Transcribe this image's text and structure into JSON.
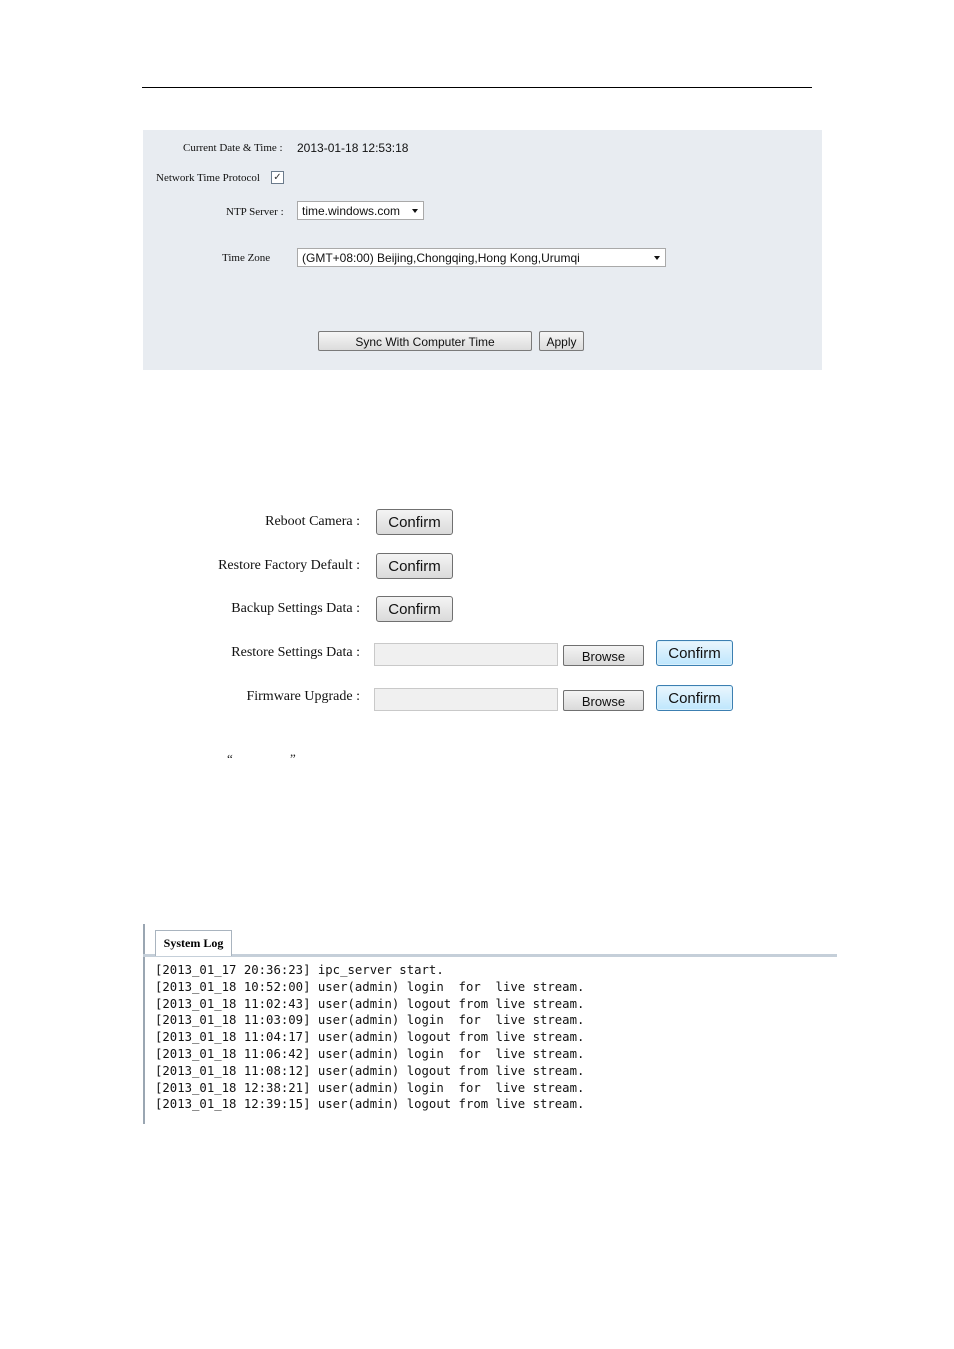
{
  "time_settings": {
    "current_datetime_label": "Current Date & Time :",
    "current_datetime_value": "2013-01-18 12:53:18",
    "ntp_label": "Network Time Protocol",
    "ntp_checked": true,
    "ntp_check_glyph": "✓",
    "ntp_server_label": "NTP Server :",
    "ntp_server_value": "time.windows.com",
    "timezone_label": "Time Zone",
    "timezone_value": "(GMT+08:00) Beijing,Chongqing,Hong Kong,Urumqi",
    "sync_button": "Sync With Computer Time",
    "apply_button": "Apply"
  },
  "maintenance": {
    "reboot_label": "Reboot Camera :",
    "restore_default_label": "Restore Factory Default :",
    "backup_label": "Backup Settings Data :",
    "restore_settings_label": "Restore Settings Data :",
    "firmware_label": "Firmware Upgrade :",
    "confirm_button": "Confirm",
    "browse_button": "Browse",
    "open_quote": "“",
    "close_quote": "”"
  },
  "system_log": {
    "tab_label": "System Log",
    "lines": [
      "[2013_01_17 20:36:23] ipc_server start.",
      "[2013_01_18 10:52:00] user(admin) login  for  live stream.",
      "[2013_01_18 11:02:43] user(admin) logout from live stream.",
      "[2013_01_18 11:03:09] user(admin) login  for  live stream.",
      "[2013_01_18 11:04:17] user(admin) logout from live stream.",
      "[2013_01_18 11:06:42] user(admin) login  for  live stream.",
      "[2013_01_18 11:08:12] user(admin) logout from live stream.",
      "[2013_01_18 12:38:21] user(admin) login  for  live stream.",
      "[2013_01_18 12:39:15] user(admin) logout from live stream."
    ]
  }
}
